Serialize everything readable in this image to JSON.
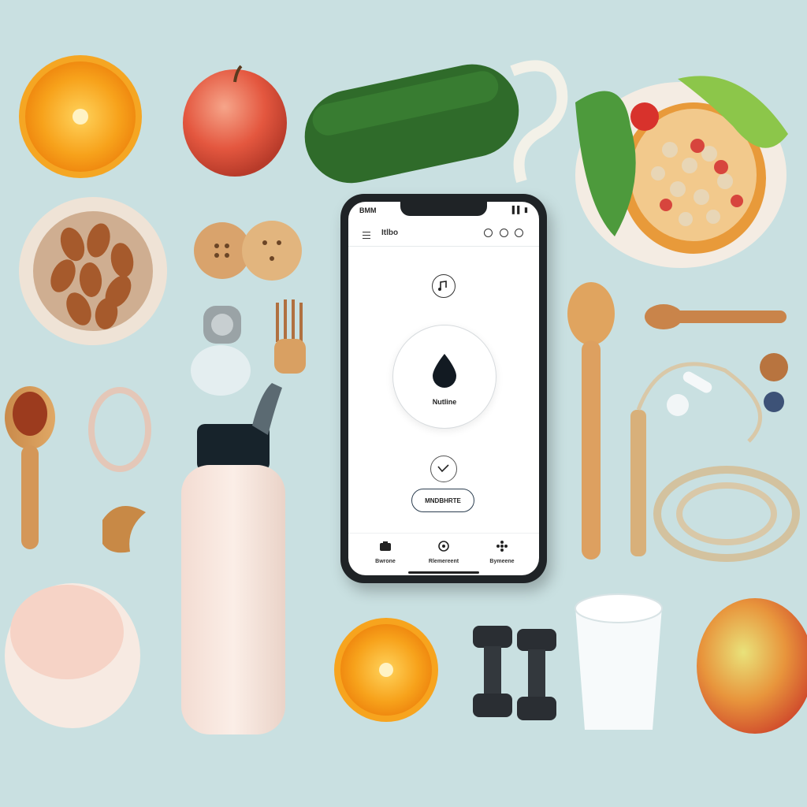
{
  "status_bar": {
    "left": "BMM",
    "right": "▌▌ ▮"
  },
  "app": {
    "title": "Itlbo"
  },
  "main": {
    "label": "Nutline",
    "action_button": "MNDBHRTE"
  },
  "nav": {
    "items": [
      {
        "label": "Bwrone"
      },
      {
        "label": "Rlemereent"
      },
      {
        "label": "Bymeene"
      }
    ]
  },
  "colors": {
    "background": "#c9e0e1",
    "phone_frame": "#1f2326",
    "accent": "#2c3e50"
  }
}
